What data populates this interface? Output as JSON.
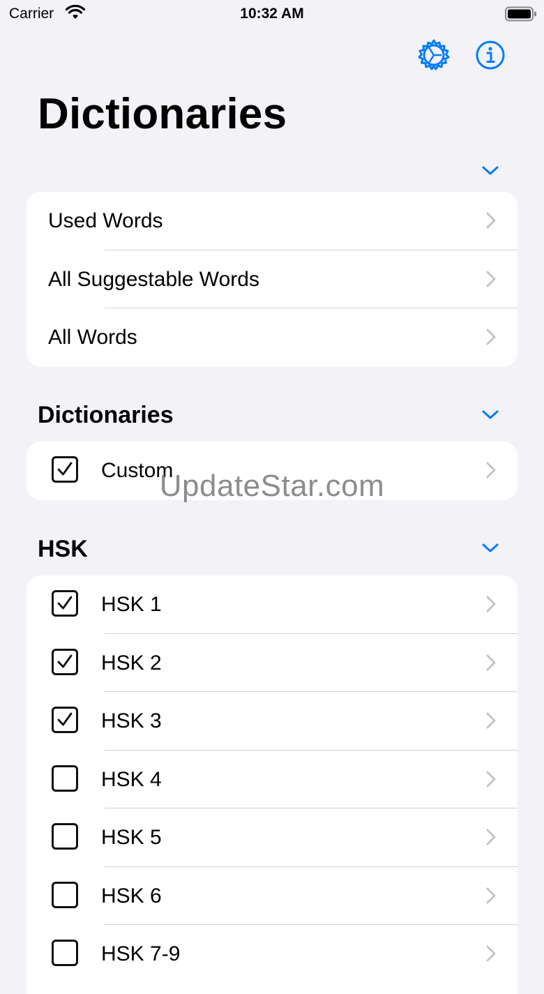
{
  "status_bar": {
    "carrier": "Carrier",
    "time": "10:32 AM"
  },
  "header": {
    "title": "Dictionaries"
  },
  "colors": {
    "accent": "#007aff",
    "chevron": "#c4c4c7",
    "background": "#f2f2f7"
  },
  "top_list": {
    "items": [
      {
        "label": "Used Words"
      },
      {
        "label": "All Suggestable Words"
      },
      {
        "label": "All Words"
      }
    ]
  },
  "dictionaries_section": {
    "header": "Dictionaries",
    "items": [
      {
        "label": "Custom",
        "checked": true
      }
    ]
  },
  "hsk_section": {
    "header": "HSK",
    "items": [
      {
        "label": "HSK 1",
        "checked": true
      },
      {
        "label": "HSK 2",
        "checked": true
      },
      {
        "label": "HSK 3",
        "checked": true
      },
      {
        "label": "HSK 4",
        "checked": false
      },
      {
        "label": "HSK 5",
        "checked": false
      },
      {
        "label": "HSK 6",
        "checked": false
      },
      {
        "label": "HSK 7-9",
        "checked": false
      }
    ]
  },
  "watermark": "UpdateStar.com"
}
